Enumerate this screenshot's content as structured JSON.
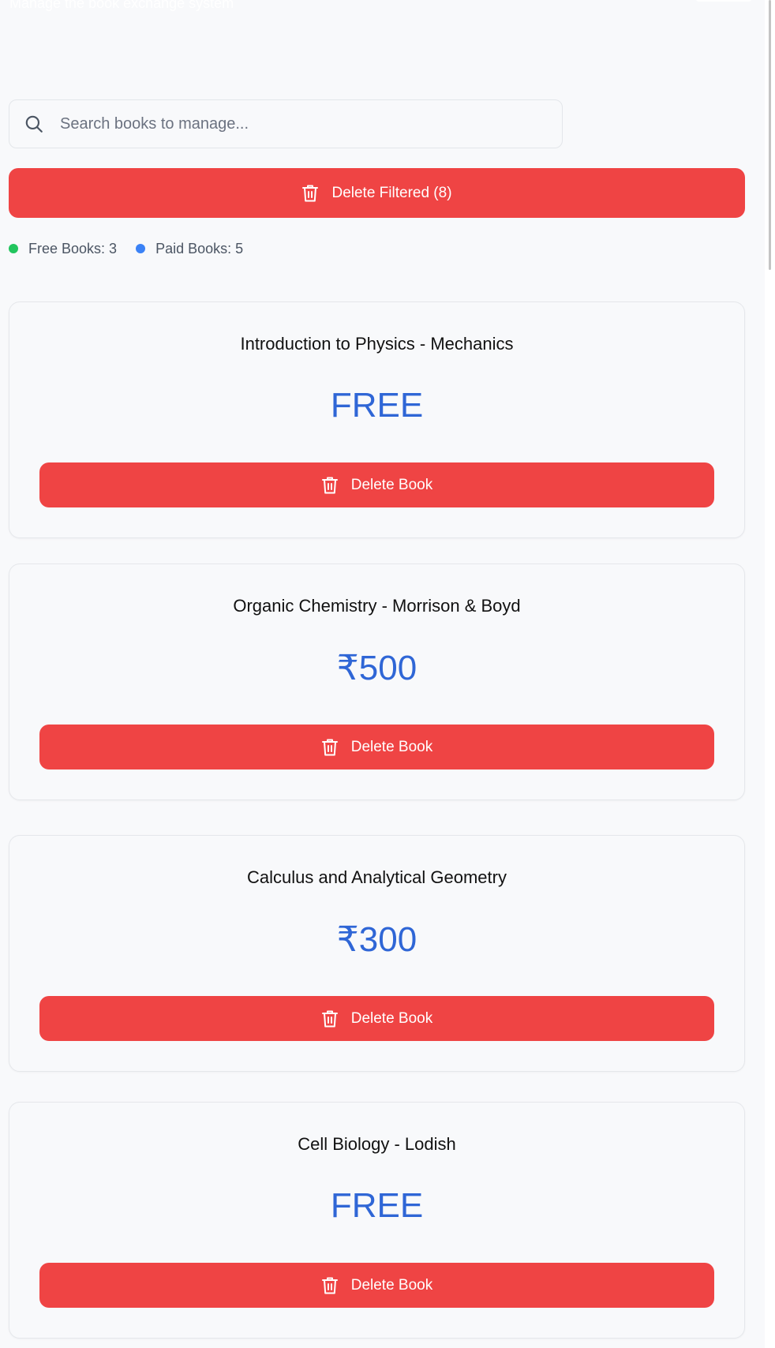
{
  "header": {
    "subtitle": "Manage the book exchange system"
  },
  "search": {
    "placeholder": "Search books to manage...",
    "value": ""
  },
  "delete_filtered_label": "Delete Filtered (8)",
  "stats": {
    "free_label": "Free Books: 3",
    "paid_label": "Paid Books: 5",
    "free_color": "#22c55e",
    "paid_color": "#3b82f6"
  },
  "books": [
    {
      "title": "Introduction to Physics - Mechanics",
      "price": "FREE",
      "delete_label": "Delete Book"
    },
    {
      "title": "Organic Chemistry - Morrison & Boyd",
      "price": "₹500",
      "delete_label": "Delete Book"
    },
    {
      "title": "Calculus and Analytical Geometry",
      "price": "₹300",
      "delete_label": "Delete Book"
    },
    {
      "title": "Cell Biology - Lodish",
      "price": "FREE",
      "delete_label": "Delete Book"
    }
  ],
  "colors": {
    "danger": "#ef4444",
    "price": "#2f66d6",
    "background": "#f8f9fb"
  },
  "icons": {
    "search": "search-icon",
    "delete": "trash-icon",
    "free_dot": "green-dot",
    "paid_dot": "blue-dot"
  }
}
